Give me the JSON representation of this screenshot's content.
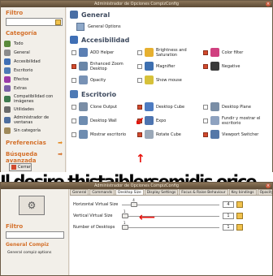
{
  "window_title": "Administrador de Opciones CompizConfig",
  "sidebar": {
    "filter_label": "Filtro",
    "category_label": "Categoría",
    "categories": [
      {
        "label": "Todo"
      },
      {
        "label": "General"
      },
      {
        "label": "Accesibilidad"
      },
      {
        "label": "Escritorio"
      },
      {
        "label": "Efectos"
      },
      {
        "label": "Extras"
      },
      {
        "label": "Compatibilidad con imágenes"
      },
      {
        "label": "Utilidades"
      },
      {
        "label": "Administrador de ventanas"
      },
      {
        "label": "Sin categoría"
      }
    ],
    "preferences_label": "Preferencias",
    "advanced_search_label": "Búsqueda avanzada",
    "close_label": "Cerrar"
  },
  "main": {
    "general": {
      "title": "General",
      "options_label": "General Options"
    },
    "accessibility": {
      "title": "Accesibilidad",
      "plugins": [
        {
          "label": "ADD Helper",
          "checked": false,
          "color": "#5b7fb3"
        },
        {
          "label": "Brightness and Saturation",
          "checked": false,
          "color": "#e6b030"
        },
        {
          "label": "Color filter",
          "checked": true,
          "color": "#d04080"
        },
        {
          "label": "Enhanced Zoom Desktop",
          "checked": true,
          "color": "#6a86a8"
        },
        {
          "label": "Magnifier",
          "checked": false,
          "color": "#3d6fb0"
        },
        {
          "label": "Negative",
          "checked": true,
          "color": "#3a3a3a"
        },
        {
          "label": "Opacity",
          "checked": false,
          "color": "#7892b5"
        },
        {
          "label": "Show mouse",
          "checked": false,
          "color": "#d6c13a"
        }
      ]
    },
    "desktop": {
      "title": "Escritorio",
      "plugins": [
        {
          "label": "Clone Output",
          "checked": false,
          "color": "#7a8ea6"
        },
        {
          "label": "Desktop Cube",
          "checked": true,
          "color": "#4d7bc1"
        },
        {
          "label": "Desktop Plane",
          "checked": false,
          "color": "#7a8ea6"
        },
        {
          "label": "Desktop Wall",
          "checked": false,
          "color": "#6e8cb0"
        },
        {
          "label": "Expo",
          "checked": true,
          "color": "#4d74b0"
        },
        {
          "label": "Fundir y mostrar el escritorio",
          "checked": false,
          "color": "#8ea2c0"
        },
        {
          "label": "Mostrar escritorio",
          "checked": false,
          "color": "#6e8cb0"
        },
        {
          "label": "Rotate Cube",
          "checked": true,
          "color": "#9aa8b8"
        },
        {
          "label": "Viewport Switcher",
          "checked": true,
          "color": "#5578a8"
        }
      ]
    }
  },
  "overlay_text": "Il desire thistaiblersemidis orice",
  "second_window": {
    "title": "Administrador de Opciones CompizConfig",
    "filter_label": "Filtro",
    "general_label": "General Compiz",
    "general_sub": "General compiz options",
    "tabs": [
      "General",
      "Commands",
      "Desktop Size",
      "Display Settings",
      "Focus & Raise Behaviour",
      "Key bindings",
      "Opacity Settings"
    ],
    "active_tab": "Desktop Size",
    "settings": [
      {
        "label": "Horizontal Virtual Size",
        "value": "4",
        "slider_fraction": 0.1
      },
      {
        "label": "Vertical Virtual Size",
        "value": "1",
        "slider_fraction": 0.0
      },
      {
        "label": "Number of Desktops",
        "value": "1",
        "slider_fraction": 0.0
      }
    ]
  }
}
